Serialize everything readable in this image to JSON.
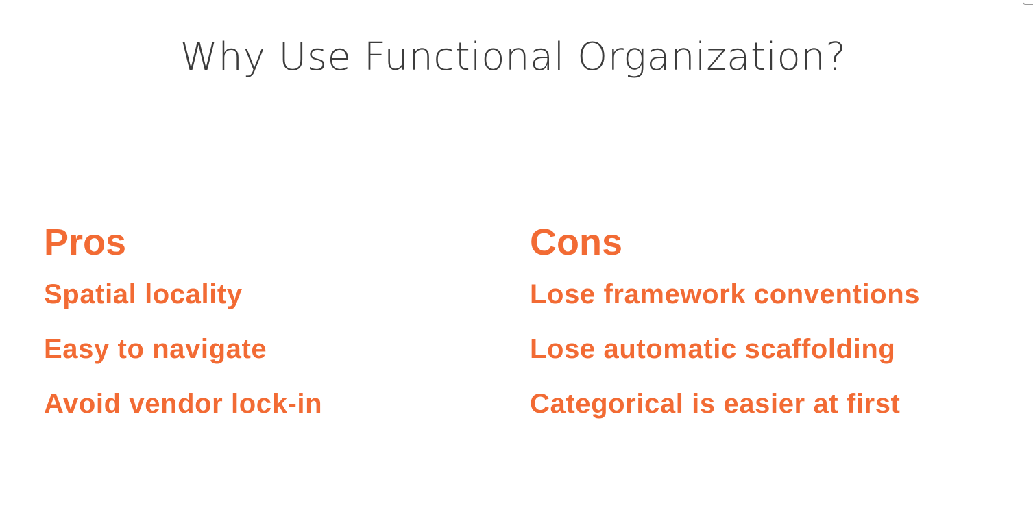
{
  "slide": {
    "title": "Why Use Functional Organization?",
    "pros": {
      "heading": "Pros",
      "items": [
        "Spatial locality",
        "Easy to navigate",
        "Avoid vendor lock-in"
      ]
    },
    "cons": {
      "heading": "Cons",
      "items": [
        "Lose framework conventions",
        "Lose automatic scaffolding",
        "Categorical is easier at first"
      ]
    }
  },
  "colors": {
    "accent": "#f26b34",
    "title": "#3c3c3c",
    "background": "#ffffff"
  }
}
